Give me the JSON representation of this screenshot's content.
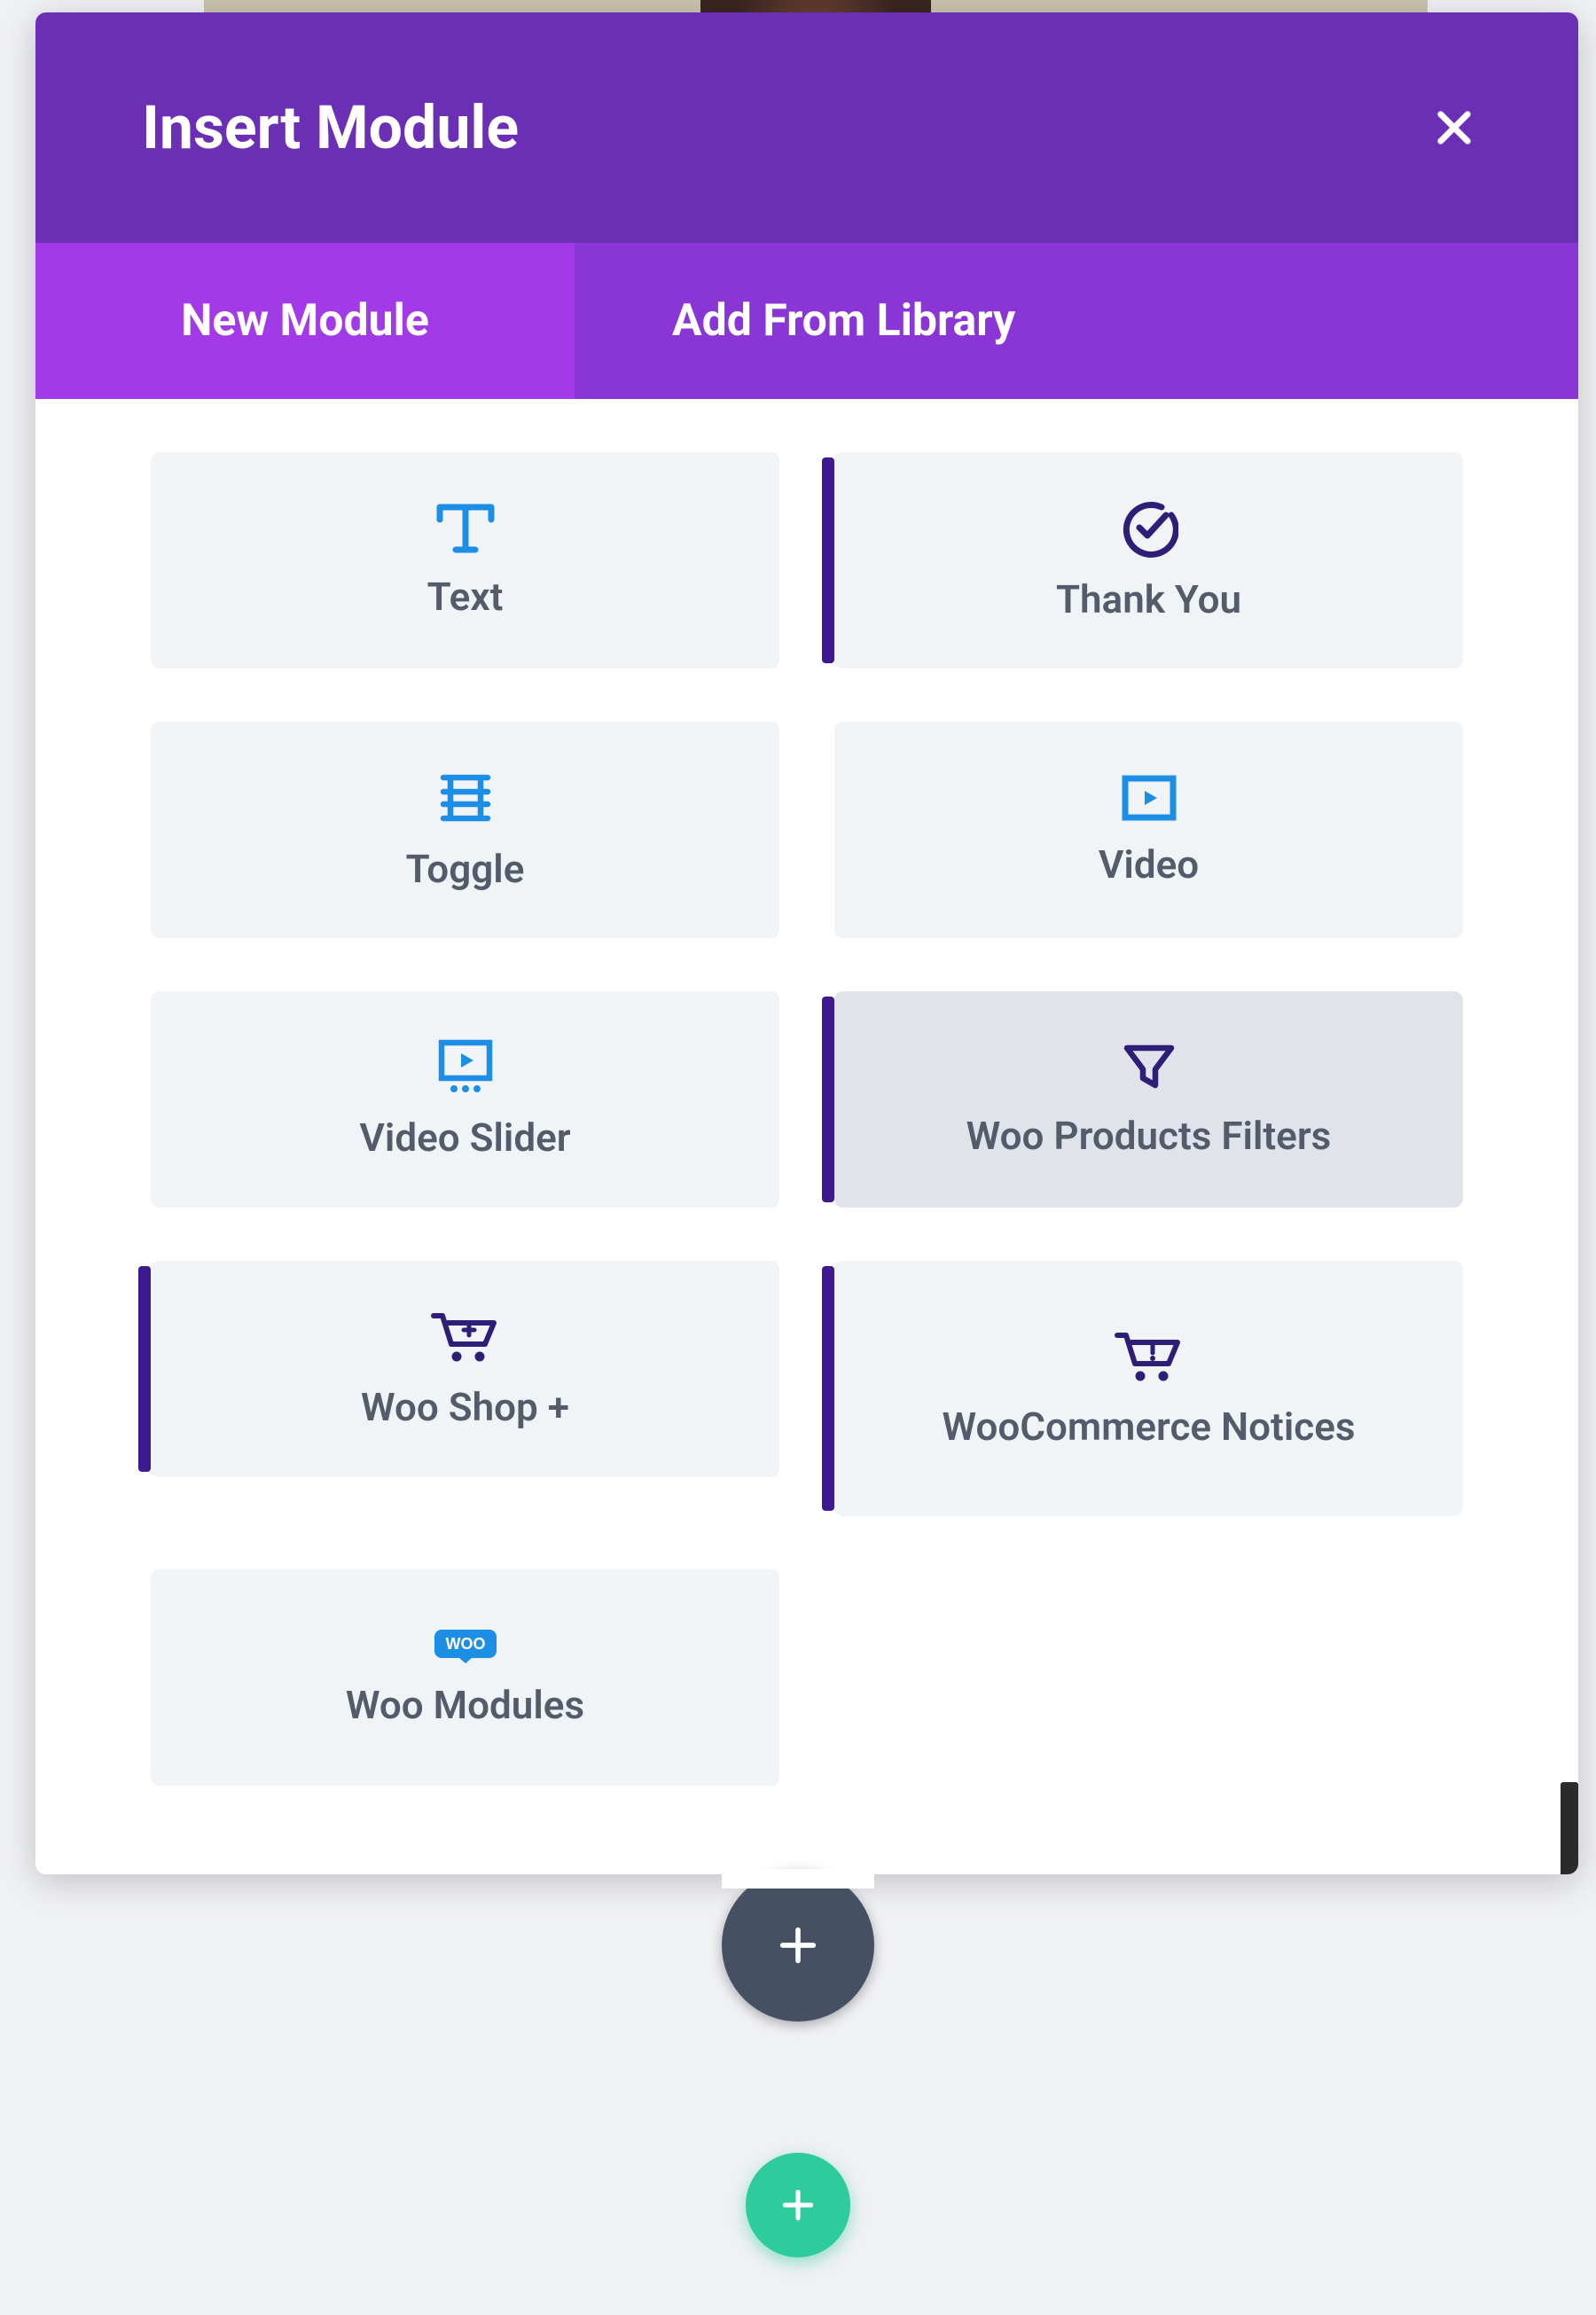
{
  "modal": {
    "title": "Insert Module",
    "tabs": {
      "new": "New Module",
      "library": "Add From Library"
    }
  },
  "colors": {
    "header": "#6b2fb5",
    "tab_active": "#a23ae8",
    "tab_inactive": "#8a36d6",
    "icon_blue": "#1d8ee6",
    "icon_indigo": "#2f1e78",
    "card_bg": "#f1f4f7",
    "card_hover": "#e0e3ea",
    "accent_bar": "#3d1a8f",
    "fab_dark": "#455062",
    "fab_teal": "#2ecb9c"
  },
  "modules": {
    "text": {
      "label": "Text",
      "accent": false
    },
    "thank_you": {
      "label": "Thank You",
      "accent": true
    },
    "toggle": {
      "label": "Toggle",
      "accent": false
    },
    "video": {
      "label": "Video",
      "accent": false
    },
    "video_slider": {
      "label": "Video Slider",
      "accent": false
    },
    "woo_products_filters": {
      "label": "Woo Products Filters",
      "accent": true,
      "hovered": true
    },
    "woo_shop_plus": {
      "label": "Woo Shop +",
      "accent": true
    },
    "woocommerce_notices": {
      "label": "WooCommerce Notices",
      "accent": true
    },
    "woo_modules": {
      "label": "Woo Modules",
      "accent": false
    }
  }
}
